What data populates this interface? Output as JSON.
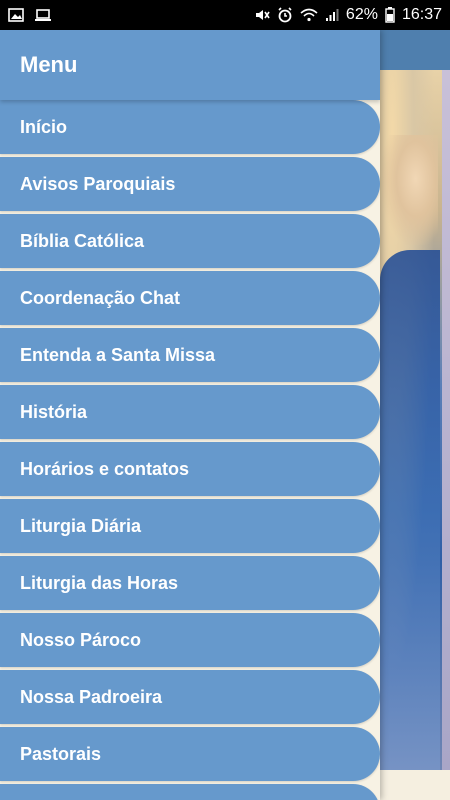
{
  "status_bar": {
    "battery": "62%",
    "time": "16:37",
    "icons_left": [
      "image-icon",
      "laptop-icon"
    ],
    "icons_right": [
      "mute-icon",
      "alarm-icon",
      "wifi-icon",
      "signal-icon",
      "battery-icon"
    ]
  },
  "drawer": {
    "title": "Menu",
    "items": [
      {
        "label": "Início"
      },
      {
        "label": "Avisos Paroquiais"
      },
      {
        "label": "Bíblia Católica"
      },
      {
        "label": "Coordenação Chat"
      },
      {
        "label": "Entenda a Santa Missa"
      },
      {
        "label": "História"
      },
      {
        "label": "Horários e contatos"
      },
      {
        "label": "Liturgia Diária"
      },
      {
        "label": "Liturgia das Horas"
      },
      {
        "label": "Nosso Pároco"
      },
      {
        "label": "Nossa Padroeira"
      },
      {
        "label": "Pastorais"
      },
      {
        "label": ""
      }
    ]
  },
  "colors": {
    "accent": "#6699cc",
    "drawer_background": "#f7f2e4",
    "toolbar_behind": "#4f7fae"
  }
}
